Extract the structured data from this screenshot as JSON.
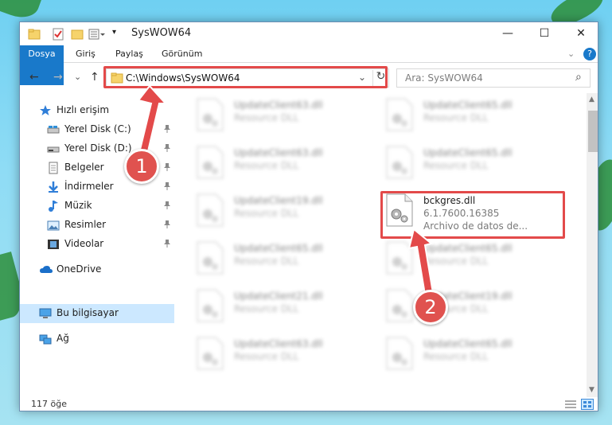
{
  "window": {
    "title": "SysWOW64",
    "minimize": "—",
    "maximize": "☐",
    "close": "✕"
  },
  "ribbon": {
    "tabs": [
      "Dosya",
      "Giriş",
      "Paylaş",
      "Görünüm"
    ],
    "help": "?",
    "expand": "⌄"
  },
  "nav": {
    "back": "←",
    "forward": "→",
    "recent": "⌄",
    "up": "↑",
    "address": "C:\\Windows\\SysWOW64",
    "address_dropdown": "⌄",
    "refresh": "↻",
    "search_placeholder": "Ara: SysWOW64",
    "search_icon": "⌕"
  },
  "sidebar": {
    "items": [
      {
        "label": "Hızlı erişim",
        "icon": "star-icon"
      },
      {
        "label": "Yerel Disk (C:)",
        "icon": "drive-icon",
        "pinned": true
      },
      {
        "label": "Yerel Disk (D:)",
        "icon": "drive-icon",
        "pinned": true
      },
      {
        "label": "Belgeler",
        "icon": "documents-icon",
        "pinned": true
      },
      {
        "label": "İndirmeler",
        "icon": "download-icon",
        "pinned": true
      },
      {
        "label": "Müzik",
        "icon": "music-icon",
        "pinned": true
      },
      {
        "label": "Resimler",
        "icon": "pictures-icon",
        "pinned": true
      },
      {
        "label": "Videolar",
        "icon": "videos-icon",
        "pinned": true
      },
      {
        "label": "OneDrive",
        "icon": "cloud-icon"
      },
      {
        "label": "Bu bilgisayar",
        "icon": "computer-icon",
        "selected": true
      },
      {
        "label": "Ağ",
        "icon": "network-icon"
      }
    ],
    "pin_glyph": "📌"
  },
  "files": {
    "left": [
      {
        "name": "UpdateClient63.dll",
        "type": "Resource DLL"
      },
      {
        "name": "UpdateClient63.dll",
        "type": "Resource DLL"
      },
      {
        "name": "UpdateClient19.dll",
        "type": "Resource DLL"
      },
      {
        "name": "UpdateClient65.dll",
        "type": "Resource DLL"
      },
      {
        "name": "UpdateClient21.dll",
        "type": "Resource DLL"
      },
      {
        "name": "UpdateClient63.dll",
        "type": "Resource DLL"
      }
    ],
    "right": [
      {
        "name": "UpdateClient65.dll",
        "type": "Resource DLL"
      },
      {
        "name": "UpdateClient65.dll",
        "type": "Resource DLL"
      },
      {
        "name": "bckgres.dll",
        "version": "6.1.7600.16385",
        "type": "Archivo de datos de..."
      },
      {
        "name": "UpdateClient65.dll",
        "type": "Resource DLL"
      },
      {
        "name": "UpdateClient19.dll",
        "type": "Resource DLL"
      },
      {
        "name": "UpdateClient65.dll",
        "type": "Resource DLL"
      }
    ]
  },
  "status": {
    "count": "117 öğe"
  },
  "annotations": {
    "badge1": "1",
    "badge2": "2",
    "color": "#e34a4a"
  }
}
